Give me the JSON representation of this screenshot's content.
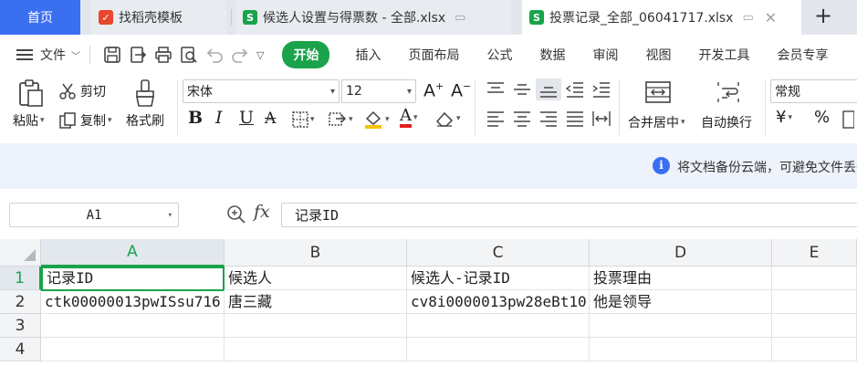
{
  "tabs": [
    {
      "label": "首页"
    },
    {
      "label": "找稻壳模板"
    },
    {
      "label": "候选人设置与得票数 - 全部.xlsx"
    },
    {
      "label": "投票记录_全部_06041717.xlsx"
    }
  ],
  "menu": {
    "file": "文件",
    "items": [
      "开始",
      "插入",
      "页面布局",
      "公式",
      "数据",
      "审阅",
      "视图",
      "开发工具",
      "会员专享"
    ]
  },
  "ribbon": {
    "paste": "粘贴",
    "cut": "剪切",
    "copy": "复制",
    "format_painter": "格式刷",
    "font_name": "宋体",
    "font_size": "12",
    "merge_center": "合并居中",
    "wrap_text": "自动换行",
    "number_format": "常规"
  },
  "info": {
    "text": "将文档备份云端，可避免文件丢失"
  },
  "formula_bar": {
    "name_box": "A1",
    "fx": "fx",
    "content": "记录ID"
  },
  "sheet": {
    "columns": [
      "A",
      "B",
      "C",
      "D",
      "E"
    ],
    "rows": [
      "1",
      "2",
      "3",
      "4"
    ],
    "cells": [
      [
        "记录ID",
        "候选人",
        "候选人-记录ID",
        "投票理由",
        ""
      ],
      [
        "ctk00000013pwISsu716",
        "唐三藏",
        "cv8i0000013pw28eBt10",
        "他是领导",
        ""
      ],
      [
        "",
        "",
        "",
        "",
        ""
      ],
      [
        "",
        "",
        "",
        "",
        ""
      ]
    ]
  },
  "colors": {
    "accent_green": "#1aa34a",
    "home_tab_blue": "#3a6ff0",
    "info_bar_bg": "#eef2fb"
  }
}
